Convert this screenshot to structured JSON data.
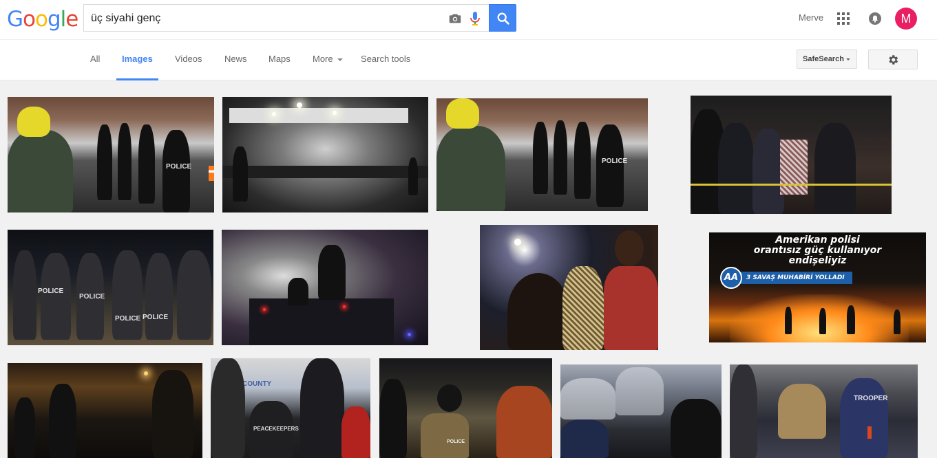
{
  "header": {
    "logo_letters": [
      {
        "ch": "G",
        "color": "#4285f4"
      },
      {
        "ch": "o",
        "color": "#ea4335"
      },
      {
        "ch": "o",
        "color": "#fbbc05"
      },
      {
        "ch": "g",
        "color": "#4285f4"
      },
      {
        "ch": "l",
        "color": "#34a853"
      },
      {
        "ch": "e",
        "color": "#ea4335"
      }
    ],
    "search_query": "üç siyahi genç",
    "camera_icon": "camera-icon",
    "mic_icon": "microphone-icon",
    "search_button_icon": "magnifier-icon",
    "search_button_color": "#4285f4",
    "user_name": "Merve",
    "avatar_initial": "M",
    "avatar_color": "#e91e63"
  },
  "nav": {
    "tabs": [
      {
        "label": "All",
        "active": false
      },
      {
        "label": "Images",
        "active": true
      },
      {
        "label": "Videos",
        "active": false
      },
      {
        "label": "News",
        "active": false
      },
      {
        "label": "Maps",
        "active": false
      },
      {
        "label": "More",
        "active": false
      },
      {
        "label": "Search tools",
        "active": false
      }
    ],
    "safesearch_label": "SafeSearch",
    "settings_icon": "gear-icon",
    "active_color": "#4285f4"
  },
  "results": {
    "aa_image_text": {
      "line1": "Amerikan polisi",
      "line2": "orantısız güç kullanıyor",
      "line3": "endişeliyiz",
      "logo": "AA",
      "ribbon": "3 SAVAŞ MUHABİRİ YOLLADI"
    },
    "police_text": "POLICE",
    "peacekeepers_text": "PEACEKEEPERS",
    "trooper_text": "TROOPER",
    "county_text": "COUNTY"
  }
}
